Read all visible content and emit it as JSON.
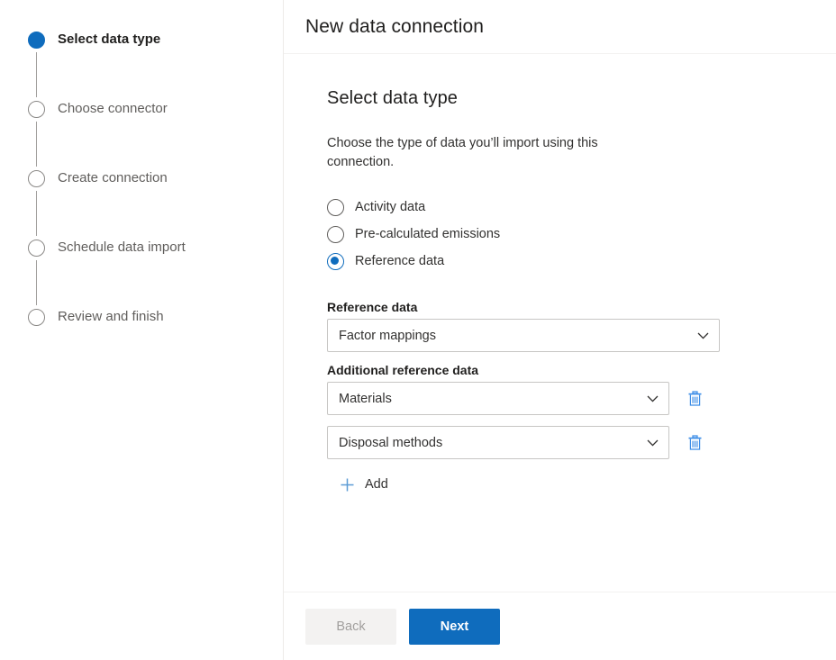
{
  "theme": {
    "accent": "#0f6cbd",
    "text_primary": "#201f1e",
    "text_secondary": "#605e5c",
    "border": "#c7c6c4",
    "divider": "#edebe9",
    "disabled_bg": "#f3f2f1",
    "disabled_text": "#a19f9d"
  },
  "stepper": {
    "steps": [
      {
        "label": "Select data type",
        "state": "active"
      },
      {
        "label": "Choose connector",
        "state": "inactive"
      },
      {
        "label": "Create connection",
        "state": "inactive"
      },
      {
        "label": "Schedule data import",
        "state": "inactive"
      },
      {
        "label": "Review and finish",
        "state": "inactive"
      }
    ]
  },
  "header": {
    "title": "New data connection"
  },
  "main": {
    "section_title": "Select data type",
    "description": "Choose the type of data you’ll import using this connection.",
    "data_type_options": [
      {
        "label": "Activity data",
        "checked": false
      },
      {
        "label": "Pre-calculated emissions",
        "checked": false
      },
      {
        "label": "Reference data",
        "checked": true
      }
    ],
    "reference_data": {
      "label": "Reference data",
      "value": "Factor mappings"
    },
    "additional_reference_data": {
      "label": "Additional reference data",
      "rows": [
        {
          "value": "Materials",
          "delete_icon": "trash-icon"
        },
        {
          "value": "Disposal methods",
          "delete_icon": "trash-icon"
        }
      ],
      "add_label": "Add",
      "add_icon": "plus-icon"
    }
  },
  "footer": {
    "back_label": "Back",
    "next_label": "Next"
  },
  "icons": {
    "chevron": "chevron-down-icon"
  }
}
